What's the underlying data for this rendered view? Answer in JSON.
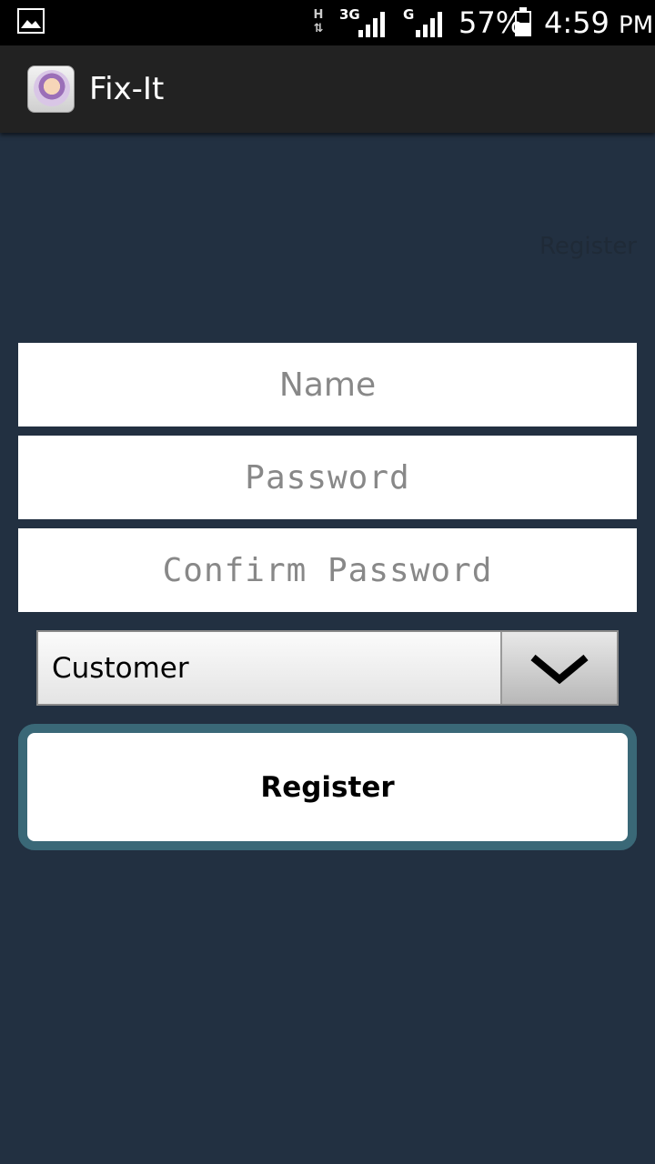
{
  "status_bar": {
    "network_h": "H",
    "network_3g": "3G",
    "network_g": "G",
    "battery_percent": "57%",
    "time": "4:59",
    "time_suffix": "PM",
    "battery_level": 0.57
  },
  "action_bar": {
    "title": "Fix-It",
    "icon": "app-logo-icon"
  },
  "ghost_label": "Register",
  "form": {
    "name_placeholder": "Name",
    "password_placeholder": "Password",
    "confirm_password_placeholder": "Confirm Password",
    "user_type_selected": "Customer",
    "register_label": "Register"
  },
  "colors": {
    "background": "#223041",
    "action_bar": "#222222",
    "button_border": "#3a6877"
  }
}
